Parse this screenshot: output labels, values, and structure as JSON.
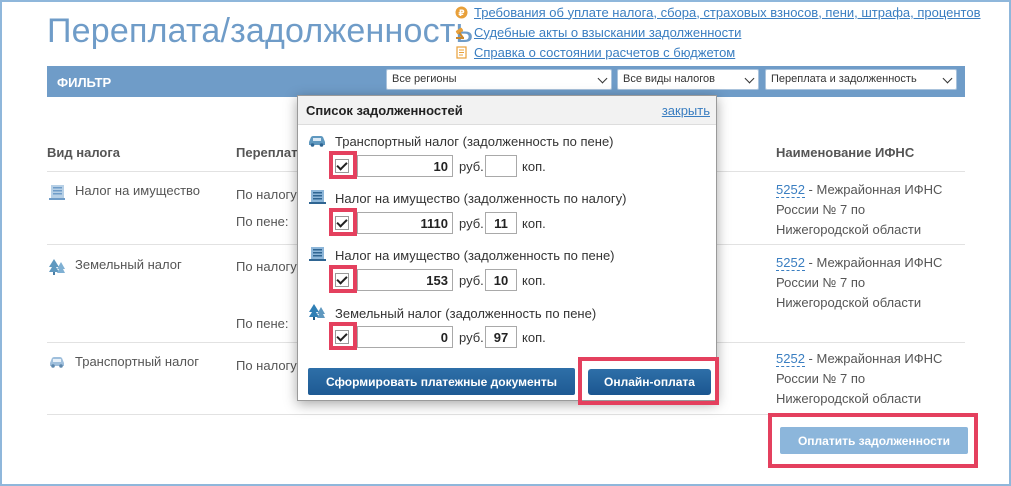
{
  "page_title": "Переплата/задолженность",
  "top_links": [
    {
      "icon": "ruble-coin-icon",
      "label": "Требования об уплате налога, сбора, страховых взносов, пени, штрафа, процентов"
    },
    {
      "icon": "gavel-icon",
      "label": "Судебные акты о взыскании задолженности"
    },
    {
      "icon": "document-icon",
      "label": "Справка о состоянии расчетов с бюджетом"
    }
  ],
  "filter": {
    "label": "ФИЛЬТР",
    "region": "Все регионы",
    "tax_type": "Все виды налогов",
    "status": "Переплата и задолженность"
  },
  "table": {
    "col_tax_type": "Вид налога",
    "col_overpay": "Переплата",
    "col_ifns": "Наименование ИФНС",
    "label_by_tax": "По налогу:",
    "label_by_penalty": "По пене:",
    "rows": [
      {
        "name": "Налог на имущество",
        "icon": "building-icon",
        "ifns_code": "5252",
        "ifns_name": " - Межрайонная ИФНС России № 7 по Нижегородской области"
      },
      {
        "name": "Земельный налог",
        "icon": "trees-icon",
        "ifns_code": "5252",
        "ifns_name": " - Межрайонная ИФНС России № 7 по Нижегородской области"
      },
      {
        "name": "Транспортный налог",
        "icon": "car-icon",
        "ifns_code": "5252",
        "ifns_name": " - Межрайонная ИФНС России № 7 по Нижегородской области"
      }
    ],
    "truncated_value": "3"
  },
  "pay_debts_button": "Оплатить задолженности",
  "popup": {
    "title": "Список задолженностей",
    "close_label": "закрыть",
    "rub_unit": "руб.",
    "kop_unit": "коп.",
    "items": [
      {
        "title": "Транспортный налог (задолженность по пене)",
        "icon": "car-icon",
        "checked": true,
        "rub": "10",
        "kop": ""
      },
      {
        "title": "Налог на имущество (задолженность по налогу)",
        "icon": "building-icon",
        "checked": true,
        "rub": "1110",
        "kop": "11"
      },
      {
        "title": "Налог на имущество (задолженность по пене)",
        "icon": "building-icon",
        "checked": true,
        "rub": "153",
        "kop": "10"
      },
      {
        "title": "Земельный налог (задолженность по пене)",
        "icon": "trees-icon",
        "checked": true,
        "rub": "0",
        "kop": "97"
      }
    ],
    "generate_button": "Сформировать платежные документы",
    "online_button": "Онлайн-оплата"
  },
  "colors": {
    "accent": "#6f9cc8",
    "link": "#3a7ec1",
    "button_dark": "#1e5a93",
    "highlight": "#e4405e"
  }
}
